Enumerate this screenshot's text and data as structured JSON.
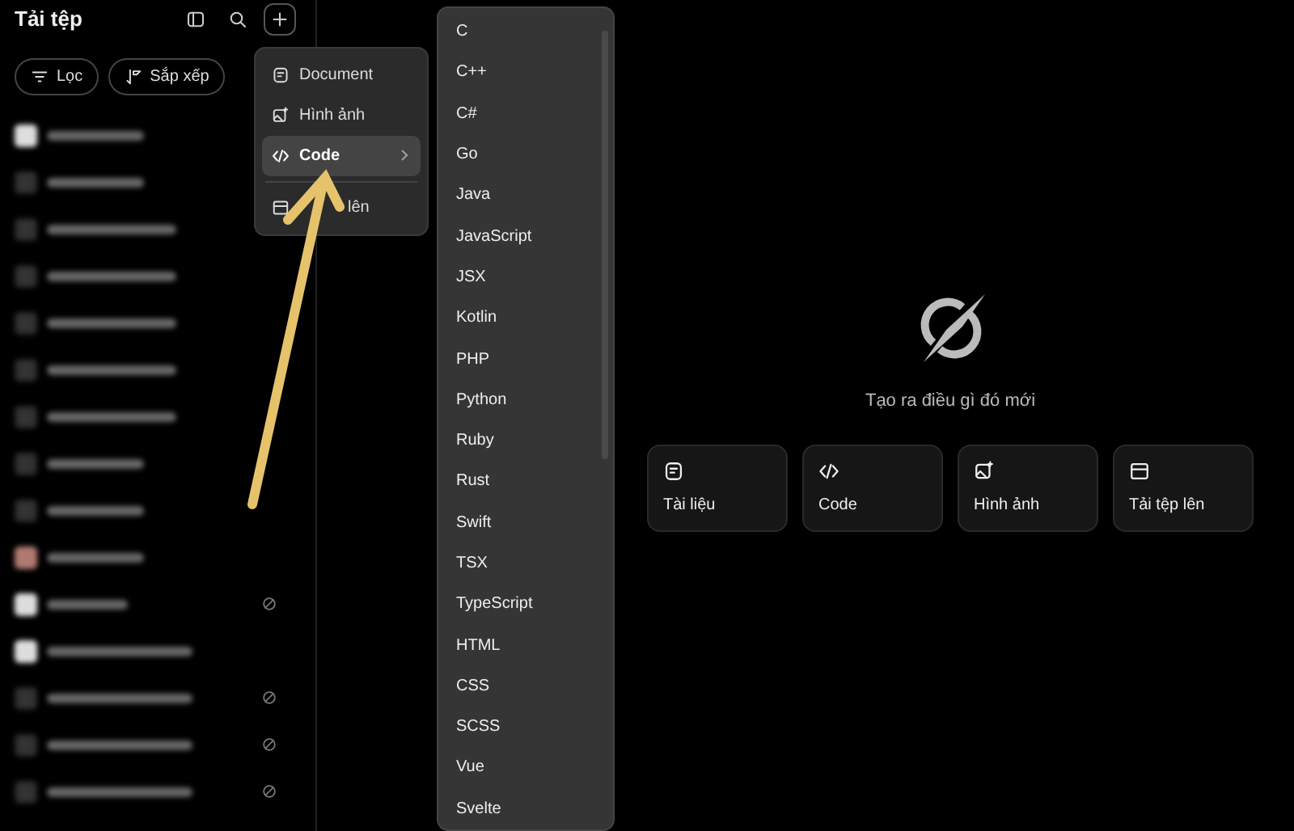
{
  "sidebar": {
    "title": "Tải tệp",
    "filters": [
      {
        "label": "Lọc",
        "kind": "filter"
      },
      {
        "label": "Sắp xếp",
        "kind": "sort"
      }
    ],
    "files": [
      {
        "kind": "light",
        "status": false
      },
      {
        "kind": "dark",
        "status": false
      },
      {
        "kind": "dark",
        "status": false
      },
      {
        "kind": "dark",
        "status": false
      },
      {
        "kind": "dark",
        "status": false
      },
      {
        "kind": "dark",
        "status": false
      },
      {
        "kind": "dark",
        "status": false
      },
      {
        "kind": "dark",
        "status": false
      },
      {
        "kind": "dark",
        "status": false
      },
      {
        "kind": "photo",
        "status": false
      },
      {
        "kind": "light",
        "status": true
      },
      {
        "kind": "light",
        "status": false
      },
      {
        "kind": "dark",
        "status": true
      },
      {
        "kind": "dark",
        "status": true
      },
      {
        "kind": "dark",
        "status": true
      }
    ]
  },
  "new_menu": {
    "items": [
      {
        "label": "Document",
        "kind": "doc",
        "selected": false,
        "submenu": false
      },
      {
        "label": "Hình ảnh",
        "kind": "image",
        "selected": false,
        "submenu": false
      },
      {
        "label": "Code",
        "kind": "code",
        "selected": true,
        "submenu": true
      },
      {
        "label": "lên",
        "kind": "folder",
        "selected": false,
        "submenu": false
      }
    ]
  },
  "languages": [
    "C",
    "C++",
    "C#",
    "Go",
    "Java",
    "JavaScript",
    "JSX",
    "Kotlin",
    "PHP",
    "Python",
    "Ruby",
    "Rust",
    "Swift",
    "TSX",
    "TypeScript",
    "HTML",
    "CSS",
    "SCSS",
    "Vue",
    "Svelte"
  ],
  "main": {
    "prompt": "Tạo ra điều gì đó mới",
    "cards": [
      {
        "label": "Tài liệu",
        "kind": "doc"
      },
      {
        "label": "Code",
        "kind": "code"
      },
      {
        "label": "Hình ảnh",
        "kind": "image"
      },
      {
        "label": "Tải tệp lên",
        "kind": "folder"
      }
    ]
  },
  "annotation": {
    "kind": "arrow"
  }
}
